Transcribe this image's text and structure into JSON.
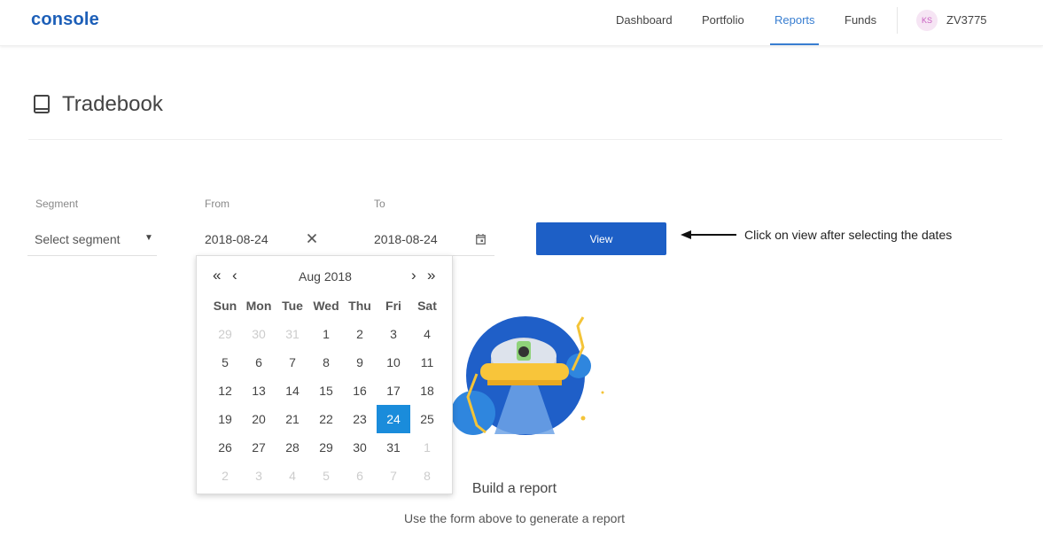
{
  "app": {
    "logo": "console"
  },
  "nav": {
    "items": [
      {
        "label": "Dashboard",
        "active": false
      },
      {
        "label": "Portfolio",
        "active": false
      },
      {
        "label": "Reports",
        "active": true
      },
      {
        "label": "Funds",
        "active": false
      }
    ],
    "accent_color": "#387ed1"
  },
  "user": {
    "initials": "KS",
    "id": "ZV3775"
  },
  "page": {
    "title": "Tradebook",
    "icon": "book-icon"
  },
  "form": {
    "segment": {
      "label": "Segment",
      "placeholder": "Select segment"
    },
    "from": {
      "label": "From",
      "value": "2018-08-24"
    },
    "to": {
      "label": "To",
      "value": "2018-08-24"
    },
    "view_label": "View",
    "button_color": "#1d5fc6"
  },
  "hint": {
    "text": "Click on view after selecting the dates"
  },
  "empty_state": {
    "title": "Build a report",
    "subtitle": "Use the form above to generate a report"
  },
  "calendar": {
    "month_label": "Aug 2018",
    "nav": {
      "prev_year": "«",
      "prev_month": "‹",
      "next_month": "›",
      "next_year": "»"
    },
    "weekdays": [
      "Sun",
      "Mon",
      "Tue",
      "Wed",
      "Thu",
      "Fri",
      "Sat"
    ],
    "weeks": [
      [
        "29",
        "30",
        "31",
        "1",
        "2",
        "3",
        "4"
      ],
      [
        "5",
        "6",
        "7",
        "8",
        "9",
        "10",
        "11"
      ],
      [
        "12",
        "13",
        "14",
        "15",
        "16",
        "17",
        "18"
      ],
      [
        "19",
        "20",
        "21",
        "22",
        "23",
        "24",
        "25"
      ],
      [
        "26",
        "27",
        "28",
        "29",
        "30",
        "31",
        "1"
      ],
      [
        "2",
        "3",
        "4",
        "5",
        "6",
        "7",
        "8"
      ]
    ],
    "selected_day": "24",
    "selected_color": "#1a8cdb"
  }
}
